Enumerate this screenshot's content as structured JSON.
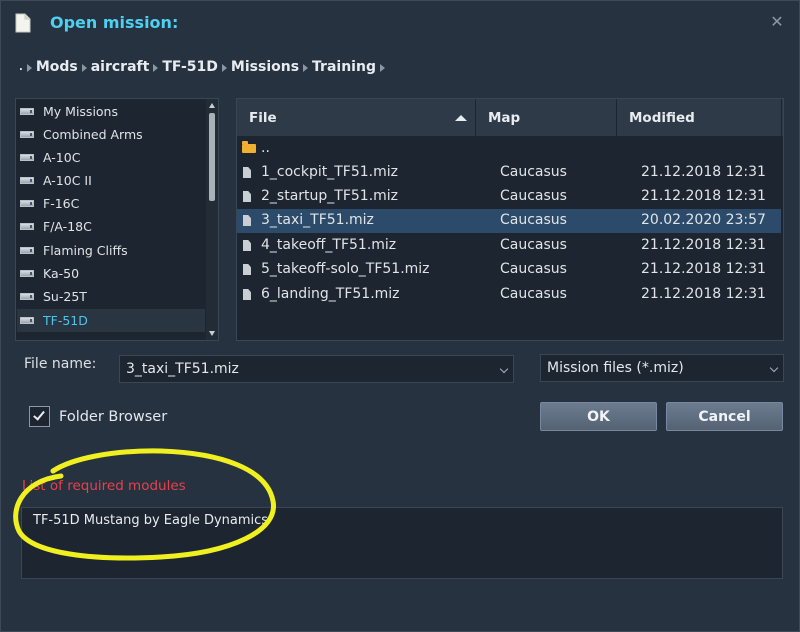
{
  "dialog": {
    "title": "Open mission:",
    "close_glyph": "✕"
  },
  "breadcrumb": {
    "root": ".",
    "items": [
      "Mods",
      "aircraft",
      "TF-51D",
      "Missions",
      "Training"
    ]
  },
  "tree": {
    "items": [
      {
        "label": "My Missions",
        "selected": false
      },
      {
        "label": "Combined Arms",
        "selected": false
      },
      {
        "label": "A-10C",
        "selected": false
      },
      {
        "label": "A-10C II",
        "selected": false
      },
      {
        "label": "F-16C",
        "selected": false
      },
      {
        "label": "F/A-18C",
        "selected": false
      },
      {
        "label": "Flaming Cliffs",
        "selected": false
      },
      {
        "label": "Ka-50",
        "selected": false
      },
      {
        "label": "Su-25T",
        "selected": false
      },
      {
        "label": "TF-51D",
        "selected": true
      }
    ]
  },
  "filelist": {
    "columns": {
      "file": "File",
      "map": "Map",
      "modified": "Modified"
    },
    "parent_label": "..",
    "rows": [
      {
        "file": "1_cockpit_TF51.miz",
        "map": "Caucasus",
        "modified": "21.12.2018 12:31",
        "selected": false
      },
      {
        "file": "2_startup_TF51.miz",
        "map": "Caucasus",
        "modified": "21.12.2018 12:31",
        "selected": false
      },
      {
        "file": "3_taxi_TF51.miz",
        "map": "Caucasus",
        "modified": "20.02.2020 23:57",
        "selected": true
      },
      {
        "file": "4_takeoff_TF51.miz",
        "map": "Caucasus",
        "modified": "21.12.2018 12:31",
        "selected": false
      },
      {
        "file": "5_takeoff-solo_TF51.miz",
        "map": "Caucasus",
        "modified": "21.12.2018 12:31",
        "selected": false
      },
      {
        "file": "6_landing_TF51.miz",
        "map": "Caucasus",
        "modified": "21.12.2018 12:31",
        "selected": false
      }
    ]
  },
  "form": {
    "file_name_label": "File name:",
    "file_name_value": "3_taxi_TF51.miz",
    "filter_value": "Mission files (*.miz)",
    "folder_browser_label": "Folder Browser",
    "folder_browser_checked": true,
    "ok_label": "OK",
    "cancel_label": "Cancel"
  },
  "modules": {
    "label": "List of required modules",
    "items": [
      "TF-51D Mustang by Eagle Dynamics"
    ]
  },
  "colors": {
    "accent": "#4fd0f0",
    "warning": "#e8404c",
    "annotation": "#f0f020",
    "selection": "#2c4a6a"
  }
}
